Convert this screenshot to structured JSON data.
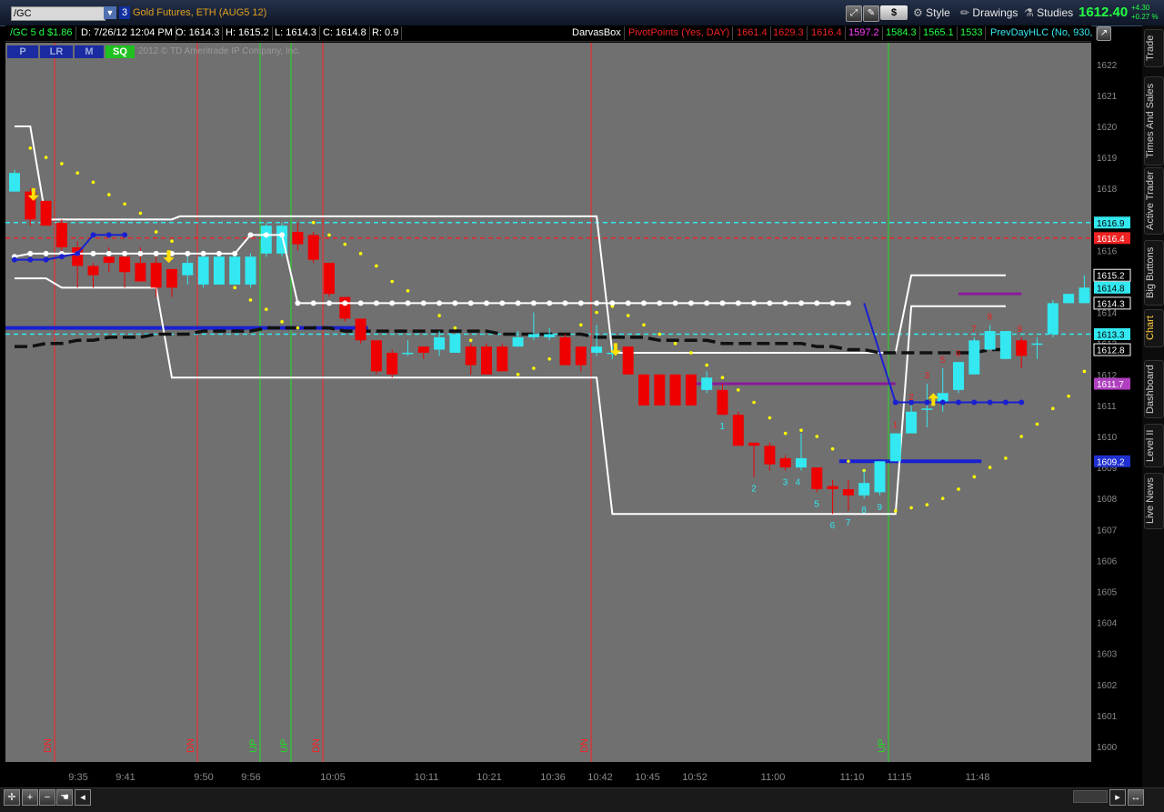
{
  "toolbar": {
    "symbol": "/GC",
    "link_number": "3",
    "description": "Gold Futures, ETH (AUG5 12)",
    "dollar_label": "$",
    "style_label": "Style",
    "drawings_label": "Drawings",
    "studies_label": "Studies",
    "last_price": "1612.40",
    "change_abs": "+4.30",
    "change_pct": "+0.27 %"
  },
  "header": {
    "period": "/GC 5 d $1.86",
    "date": "D: 7/26/12 12:04 PM",
    "open": "O: 1614.3",
    "high": "H: 1615.2",
    "low": "L: 1614.3",
    "close": "C: 1614.8",
    "range": "R: 0.9",
    "study1": "DarvasBox",
    "study2": "PivotPoints (Yes, DAY)",
    "pp1": "1661.4",
    "pp2": "1629.3",
    "pp3": "1616.4",
    "pp4": "1597.2",
    "pp5": "1584.3",
    "pp6": "1565.1",
    "pp7": "1533",
    "study3": "PrevDayHLC (No, 930,"
  },
  "buttons": [
    "P",
    "LR",
    "M",
    "SQ"
  ],
  "copyright": "2012 © TD Ameritrade IP Company, Inc.",
  "side_tabs": [
    "Trade",
    "Times And Sales",
    "Active Trader",
    "Big Buttons",
    "Chart",
    "Dashboard",
    "Level II",
    "Live News"
  ],
  "colors": {
    "up": "#33e8f0",
    "down": "#ee0000",
    "background": "#707070",
    "accent": "#22ff44"
  },
  "icons": [
    "crosshair-icon",
    "zoom-in-icon",
    "zoom-out-icon",
    "hand-icon",
    "arrow-left-icon",
    "arrow-right-icon",
    "expand-icon",
    "wrench-icon",
    "pencil-icon",
    "flask-icon"
  ],
  "chart_data": {
    "type": "candlestick",
    "ylim": [
      1599.5,
      1622.7
    ],
    "y_ticks": [
      1600,
      1601,
      1602,
      1603,
      1604,
      1605,
      1606,
      1607,
      1608,
      1609,
      1610,
      1611,
      1612,
      1613,
      1614,
      1615,
      1616,
      1617,
      1618,
      1619,
      1620,
      1621,
      1622
    ],
    "x_ticks": [
      "9:35",
      "9:41",
      "9:50",
      "9:56",
      "10:05",
      "10:11",
      "10:21",
      "10:36",
      "10:42",
      "10:45",
      "10:52",
      "11:00",
      "11:10",
      "11:15",
      "11:48"
    ],
    "price_labels": [
      {
        "text": "1616.9",
        "value": 1616.9,
        "color": "#33e8f0"
      },
      {
        "text": "1616.4",
        "value": 1616.4,
        "color": "#ee2222"
      },
      {
        "text": "1615.2",
        "value": 1615.2,
        "color": "#ffffff"
      },
      {
        "text": "1614.8",
        "value": 1614.8,
        "color": "#33e8f0"
      },
      {
        "text": "1614.3",
        "value": 1614.3,
        "color": "#ffffff"
      },
      {
        "text": "1613.3",
        "value": 1613.3,
        "color": "#33e8f0"
      },
      {
        "text": "1612.8",
        "value": 1612.8,
        "color": "#ffffff"
      },
      {
        "text": "1611.7",
        "value": 1611.7,
        "color": "#b040c0"
      },
      {
        "text": "1609.2",
        "value": 1609.2,
        "color": "#2030d0"
      }
    ],
    "candles": [
      {
        "o": 1617.9,
        "h": 1618.6,
        "l": 1617.9,
        "c": 1618.5
      },
      {
        "o": 1617.9,
        "h": 1618.0,
        "l": 1616.8,
        "c": 1617.0
      },
      {
        "o": 1617.6,
        "h": 1617.6,
        "l": 1616.8,
        "c": 1616.8
      },
      {
        "o": 1616.9,
        "h": 1617.0,
        "l": 1615.9,
        "c": 1616.1
      },
      {
        "o": 1616.1,
        "h": 1616.3,
        "l": 1614.8,
        "c": 1615.5
      },
      {
        "o": 1615.5,
        "h": 1615.6,
        "l": 1614.8,
        "c": 1615.2
      },
      {
        "o": 1615.8,
        "h": 1616.1,
        "l": 1615.3,
        "c": 1615.6
      },
      {
        "o": 1615.8,
        "h": 1616.0,
        "l": 1614.8,
        "c": 1615.3
      },
      {
        "o": 1615.6,
        "h": 1616.1,
        "l": 1615.0,
        "c": 1615.0
      },
      {
        "o": 1615.6,
        "h": 1615.8,
        "l": 1614.5,
        "c": 1614.8
      },
      {
        "o": 1615.4,
        "h": 1615.4,
        "l": 1614.5,
        "c": 1614.8
      },
      {
        "o": 1615.2,
        "h": 1615.8,
        "l": 1614.9,
        "c": 1615.6
      },
      {
        "o": 1614.9,
        "h": 1615.8,
        "l": 1614.8,
        "c": 1615.8
      },
      {
        "o": 1614.9,
        "h": 1615.9,
        "l": 1614.9,
        "c": 1615.8
      },
      {
        "o": 1614.9,
        "h": 1615.9,
        "l": 1614.9,
        "c": 1615.8
      },
      {
        "o": 1614.9,
        "h": 1615.9,
        "l": 1614.8,
        "c": 1615.8
      },
      {
        "o": 1615.9,
        "h": 1616.9,
        "l": 1615.8,
        "c": 1616.8
      },
      {
        "o": 1615.9,
        "h": 1616.9,
        "l": 1615.8,
        "c": 1616.8
      },
      {
        "o": 1616.6,
        "h": 1616.9,
        "l": 1616.0,
        "c": 1616.2
      },
      {
        "o": 1616.5,
        "h": 1616.6,
        "l": 1615.6,
        "c": 1615.7
      },
      {
        "o": 1615.6,
        "h": 1615.6,
        "l": 1614.5,
        "c": 1614.6
      },
      {
        "o": 1614.5,
        "h": 1614.5,
        "l": 1613.7,
        "c": 1613.8
      },
      {
        "o": 1613.8,
        "h": 1613.8,
        "l": 1613.0,
        "c": 1613.1
      },
      {
        "o": 1613.1,
        "h": 1613.1,
        "l": 1612.0,
        "c": 1612.1
      },
      {
        "o": 1612.7,
        "h": 1612.8,
        "l": 1611.9,
        "c": 1612.0
      },
      {
        "o": 1612.7,
        "h": 1613.1,
        "l": 1612.6,
        "c": 1612.7
      },
      {
        "o": 1612.9,
        "h": 1612.9,
        "l": 1612.5,
        "c": 1612.7
      },
      {
        "o": 1612.8,
        "h": 1613.4,
        "l": 1612.6,
        "c": 1613.2
      },
      {
        "o": 1612.7,
        "h": 1613.3,
        "l": 1612.7,
        "c": 1613.3
      },
      {
        "o": 1612.9,
        "h": 1613.0,
        "l": 1612.0,
        "c": 1612.3
      },
      {
        "o": 1612.9,
        "h": 1613.0,
        "l": 1612.0,
        "c": 1612.0
      },
      {
        "o": 1612.9,
        "h": 1613.0,
        "l": 1612.1,
        "c": 1612.1
      },
      {
        "o": 1612.9,
        "h": 1613.4,
        "l": 1612.9,
        "c": 1613.2
      },
      {
        "o": 1613.2,
        "h": 1614.0,
        "l": 1613.1,
        "c": 1613.3
      },
      {
        "o": 1613.2,
        "h": 1613.5,
        "l": 1613.1,
        "c": 1613.3
      },
      {
        "o": 1613.2,
        "h": 1613.3,
        "l": 1612.3,
        "c": 1612.3
      },
      {
        "o": 1612.9,
        "h": 1612.9,
        "l": 1612.1,
        "c": 1612.3
      },
      {
        "o": 1612.7,
        "h": 1613.6,
        "l": 1612.6,
        "c": 1612.9
      },
      {
        "o": 1612.7,
        "h": 1612.9,
        "l": 1612.5,
        "c": 1612.7
      },
      {
        "o": 1612.9,
        "h": 1612.9,
        "l": 1612.0,
        "c": 1612.0
      },
      {
        "o": 1612.0,
        "h": 1612.0,
        "l": 1611.0,
        "c": 1611.0
      },
      {
        "o": 1612.0,
        "h": 1612.0,
        "l": 1611.0,
        "c": 1611.0
      },
      {
        "o": 1612.0,
        "h": 1612.0,
        "l": 1611.0,
        "c": 1611.0
      },
      {
        "o": 1612.0,
        "h": 1612.0,
        "l": 1611.0,
        "c": 1611.0
      },
      {
        "o": 1611.5,
        "h": 1612.1,
        "l": 1611.4,
        "c": 1611.9
      },
      {
        "o": 1611.5,
        "h": 1611.7,
        "l": 1610.7,
        "c": 1610.7
      },
      {
        "o": 1610.7,
        "h": 1610.8,
        "l": 1609.7,
        "c": 1609.7
      },
      {
        "o": 1609.8,
        "h": 1609.8,
        "l": 1608.7,
        "c": 1609.7
      },
      {
        "o": 1609.7,
        "h": 1609.8,
        "l": 1608.9,
        "c": 1609.1
      },
      {
        "o": 1609.3,
        "h": 1609.4,
        "l": 1608.9,
        "c": 1609.0
      },
      {
        "o": 1609.0,
        "h": 1610.1,
        "l": 1608.9,
        "c": 1609.3
      },
      {
        "o": 1609.0,
        "h": 1609.0,
        "l": 1608.2,
        "c": 1608.3
      },
      {
        "o": 1608.4,
        "h": 1608.6,
        "l": 1607.5,
        "c": 1608.3
      },
      {
        "o": 1608.3,
        "h": 1608.6,
        "l": 1607.6,
        "c": 1608.1
      },
      {
        "o": 1608.1,
        "h": 1608.9,
        "l": 1608.0,
        "c": 1608.5
      },
      {
        "o": 1608.2,
        "h": 1609.2,
        "l": 1608.1,
        "c": 1609.2
      },
      {
        "o": 1609.2,
        "h": 1610.1,
        "l": 1609.2,
        "c": 1610.1
      },
      {
        "o": 1610.1,
        "h": 1611.0,
        "l": 1610.1,
        "c": 1610.8
      },
      {
        "o": 1610.9,
        "h": 1611.7,
        "l": 1610.3,
        "c": 1610.9
      },
      {
        "o": 1611.1,
        "h": 1612.2,
        "l": 1610.8,
        "c": 1611.4
      },
      {
        "o": 1611.5,
        "h": 1612.4,
        "l": 1611.4,
        "c": 1612.4
      },
      {
        "o": 1612.0,
        "h": 1613.2,
        "l": 1612.0,
        "c": 1613.1
      },
      {
        "o": 1612.8,
        "h": 1613.6,
        "l": 1612.8,
        "c": 1613.4
      },
      {
        "o": 1612.5,
        "h": 1613.4,
        "l": 1612.5,
        "c": 1613.4
      },
      {
        "o": 1613.1,
        "h": 1613.2,
        "l": 1612.2,
        "c": 1612.6
      },
      {
        "o": 1613.0,
        "h": 1613.2,
        "l": 1612.5,
        "c": 1613.0
      },
      {
        "o": 1613.3,
        "h": 1614.4,
        "l": 1613.2,
        "c": 1614.3
      },
      {
        "o": 1614.3,
        "h": 1614.6,
        "l": 1614.3,
        "c": 1614.6
      },
      {
        "o": 1614.3,
        "h": 1615.2,
        "l": 1614.3,
        "c": 1614.8
      }
    ],
    "count_labels_up": [
      {
        "i": 45,
        "n": "1"
      },
      {
        "i": 47,
        "n": "2"
      },
      {
        "i": 49,
        "n": "3"
      },
      {
        "i": 49.8,
        "n": "4"
      },
      {
        "i": 51,
        "n": "5"
      },
      {
        "i": 52,
        "n": "6"
      },
      {
        "i": 53,
        "n": "7"
      },
      {
        "i": 54,
        "n": "8"
      },
      {
        "i": 55,
        "n": "9"
      }
    ],
    "count_labels_down": [
      {
        "i": 56,
        "n": "1"
      },
      {
        "i": 57,
        "n": "2"
      },
      {
        "i": 58,
        "n": "3"
      },
      {
        "i": 59,
        "n": "5"
      },
      {
        "i": 60,
        "n": "6"
      },
      {
        "i": 61,
        "n": "7"
      },
      {
        "i": 62,
        "n": "8"
      },
      {
        "i": 63.9,
        "n": "9"
      }
    ],
    "vertical_markers": [
      {
        "label": "DN",
        "x": 60,
        "color": "#ff2020"
      },
      {
        "label": "DN",
        "x": 217,
        "color": "#ff2020"
      },
      {
        "label": "UP",
        "x": 286,
        "color": "#20e020"
      },
      {
        "label": "UP",
        "x": 320,
        "color": "#20e020"
      },
      {
        "label": "DN",
        "x": 355,
        "color": "#ff2020"
      },
      {
        "label": "DN",
        "x": 650,
        "color": "#ff2020"
      },
      {
        "label": "UP",
        "x": 977,
        "color": "#20e020"
      }
    ],
    "horizontal_levels": [
      {
        "value": 1616.9,
        "style": "dashed",
        "color": "#33e8f0"
      },
      {
        "value": 1616.4,
        "style": "dashed",
        "color": "#ee2222"
      },
      {
        "value": 1613.3,
        "style": "dashed",
        "color": "#33e8f0"
      }
    ],
    "darvas_upper": [
      [
        0,
        1620.0
      ],
      [
        1,
        1620.0
      ],
      [
        2,
        1617.0
      ],
      [
        10,
        1617.0
      ],
      [
        10.5,
        1617.1
      ],
      [
        37,
        1617.1
      ],
      [
        38,
        1612.7
      ],
      [
        56,
        1612.7
      ],
      [
        57,
        1615.2
      ],
      [
        63,
        1615.2
      ]
    ],
    "darvas_lower": [
      [
        0,
        1615.1
      ],
      [
        2,
        1615.1
      ],
      [
        3,
        1614.8
      ],
      [
        9,
        1614.8
      ],
      [
        10,
        1611.9
      ],
      [
        37,
        1611.9
      ],
      [
        38,
        1607.5
      ],
      [
        56,
        1607.5
      ],
      [
        57,
        1614.2
      ],
      [
        63,
        1614.2
      ]
    ],
    "white_dots_line": [
      1615.8,
      1615.9,
      1615.9,
      1615.9,
      1615.9,
      1615.9,
      1615.9,
      1615.9,
      1615.9,
      1615.9,
      1615.9,
      1615.9,
      1615.9,
      1615.9,
      1615.9,
      1616.5,
      1616.5,
      1616.5,
      1614.3,
      1614.3,
      1614.3,
      1614.3,
      1614.3,
      1614.3,
      1614.3,
      1614.3,
      1614.3,
      1614.3,
      1614.3,
      1614.3,
      1614.3,
      1614.3,
      1614.3,
      1614.3,
      1614.3,
      1614.3,
      1614.3,
      1614.3,
      1614.3,
      1614.3,
      1614.3,
      1614.3,
      1614.3,
      1614.3,
      1614.3,
      1614.3,
      1614.3,
      1614.3,
      1614.3,
      1614.3,
      1614.3,
      1614.3,
      1614.3,
      1614.3
    ],
    "blue_dots_line": [
      1615.7,
      1615.7,
      1615.7,
      1615.8,
      1615.9,
      1616.5,
      1616.5,
      1616.5
    ],
    "blue_dots_line2": [
      1611.1,
      1611.1,
      1611.1,
      1611.1,
      1611.1,
      1611.1,
      1611.1,
      1611.1,
      1611.1
    ],
    "blue_levels": [
      {
        "value": 1613.5,
        "from": 0,
        "to": 22
      },
      {
        "value": 1609.2,
        "from": 53,
        "to": 61
      }
    ],
    "purple_levels": [
      {
        "value": 1611.7,
        "from": 43,
        "to": 56
      },
      {
        "value": 1614.6,
        "from": 60,
        "to": 64
      }
    ],
    "moving_average": [
      1612.9,
      1612.9,
      1613.0,
      1613.0,
      1613.1,
      1613.1,
      1613.2,
      1613.2,
      1613.2,
      1613.3,
      1613.3,
      1613.3,
      1613.4,
      1613.4,
      1613.4,
      1613.4,
      1613.5,
      1613.5,
      1613.5,
      1613.5,
      1613.5,
      1613.4,
      1613.4,
      1613.4,
      1613.4,
      1613.4,
      1613.4,
      1613.4,
      1613.4,
      1613.4,
      1613.4,
      1613.3,
      1613.3,
      1613.3,
      1613.3,
      1613.3,
      1613.3,
      1613.2,
      1613.2,
      1613.2,
      1613.2,
      1613.1,
      1613.1,
      1613.1,
      1613.1,
      1613.0,
      1613.0,
      1613.0,
      1613.0,
      1613.0,
      1613.0,
      1612.9,
      1612.9,
      1612.8,
      1612.8,
      1612.7,
      1612.7,
      1612.7,
      1612.7,
      1612.7,
      1612.7,
      1612.7,
      1612.8,
      1612.8
    ],
    "psar_dots": [
      [
        1,
        1619.3
      ],
      [
        2,
        1619.0
      ],
      [
        3,
        1618.8
      ],
      [
        4,
        1618.5
      ],
      [
        5,
        1618.2
      ],
      [
        6,
        1617.8
      ],
      [
        7,
        1617.5
      ],
      [
        8,
        1617.2
      ],
      [
        9,
        1616.6
      ],
      [
        10,
        1616.3
      ],
      [
        11,
        1615.9
      ],
      [
        12,
        1615.5
      ],
      [
        13,
        1615.2
      ],
      [
        14,
        1614.8
      ],
      [
        15,
        1614.4
      ],
      [
        16,
        1614.1
      ],
      [
        17,
        1613.7
      ],
      [
        18,
        1613.5
      ],
      [
        19,
        1616.9
      ],
      [
        20,
        1616.5
      ],
      [
        21,
        1616.2
      ],
      [
        22,
        1615.9
      ],
      [
        23,
        1615.5
      ],
      [
        24,
        1615.0
      ],
      [
        25,
        1614.7
      ],
      [
        26,
        1614.3
      ],
      [
        27,
        1613.9
      ],
      [
        28,
        1613.5
      ],
      [
        29,
        1613.1
      ],
      [
        30,
        1612.7
      ],
      [
        31,
        1612.3
      ],
      [
        32,
        1612.0
      ],
      [
        33,
        1612.2
      ],
      [
        34,
        1612.5
      ],
      [
        35,
        1612.8
      ],
      [
        36,
        1613.6
      ],
      [
        37,
        1614.0
      ],
      [
        38,
        1614.2
      ],
      [
        39,
        1613.9
      ],
      [
        40,
        1613.6
      ],
      [
        41,
        1613.3
      ],
      [
        42,
        1613.0
      ],
      [
        43,
        1612.7
      ],
      [
        44,
        1612.3
      ],
      [
        45,
        1611.9
      ],
      [
        46,
        1611.5
      ],
      [
        47,
        1611.1
      ],
      [
        48,
        1610.6
      ],
      [
        49,
        1610.1
      ],
      [
        50,
        1610.2
      ],
      [
        51,
        1610.0
      ],
      [
        52,
        1609.6
      ],
      [
        53,
        1609.2
      ],
      [
        54,
        1608.9
      ],
      [
        55,
        1608.6
      ],
      [
        56,
        1607.6
      ],
      [
        57,
        1607.7
      ],
      [
        58,
        1607.8
      ],
      [
        59,
        1608.0
      ],
      [
        60,
        1608.3
      ],
      [
        61,
        1608.7
      ],
      [
        62,
        1609.0
      ],
      [
        63,
        1609.3
      ],
      [
        64,
        1610.0
      ],
      [
        65,
        1610.4
      ],
      [
        66,
        1610.9
      ],
      [
        67,
        1611.3
      ],
      [
        68,
        1612.1
      ],
      [
        69,
        1612.6
      ]
    ],
    "arrows": [
      {
        "i": 1.2,
        "value": 1617.6,
        "dir": "down"
      },
      {
        "i": 9.8,
        "value": 1615.6,
        "dir": "down"
      },
      {
        "i": 38.2,
        "value": 1612.6,
        "dir": "down"
      },
      {
        "i": 58.4,
        "value": 1611.4,
        "dir": "up"
      }
    ]
  }
}
